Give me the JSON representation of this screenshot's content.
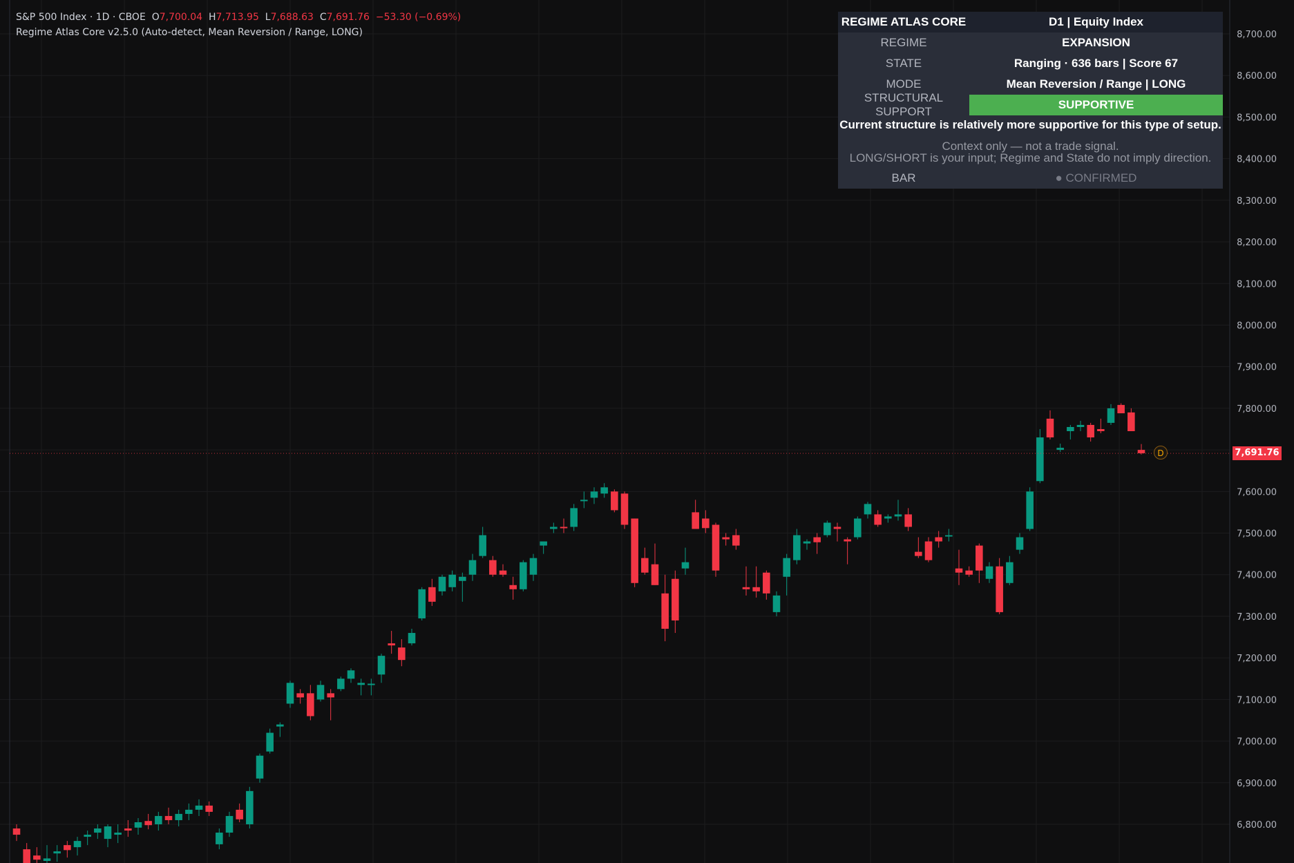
{
  "legend": {
    "symbol": "S&P 500 Index · 1D · CBOE",
    "o_label": "O",
    "o_value": "7,700.04",
    "h_label": "H",
    "h_value": "7,713.95",
    "l_label": "L",
    "l_value": "7,688.63",
    "c_label": "C",
    "c_value": "7,691.76",
    "change": "−53.30 (−0.69%)",
    "indicator": "Regime Atlas Core v2.5.0 (Auto-detect, Mean Reversion / Range, LONG)"
  },
  "panel": {
    "title": "REGIME ATLAS CORE",
    "title_value": "D1 | Equity Index",
    "regime_label": "REGIME",
    "regime_value": "EXPANSION",
    "state_label": "STATE",
    "state_value": "Ranging · 636 bars | Score 67",
    "mode_label": "MODE",
    "mode_value": "Mean Reversion / Range | LONG",
    "support_label": "STRUCTURAL SUPPORT",
    "support_value": "SUPPORTIVE",
    "note_strong": "Current structure is relatively more supportive for this type of setup.",
    "note_line1": "Context only — not a trade signal.",
    "note_line2": "LONG/SHORT is your input; Regime and State do not imply direction.",
    "bar_label": "BAR",
    "bar_value": "● CONFIRMED",
    "support_color": "#4caf50"
  },
  "price_tag": "7,691.76",
  "d_marker": "D",
  "colors": {
    "up": "#089981",
    "down": "#f23645",
    "background": "#0f0f10",
    "grid": "#1c1c1e",
    "axis_text": "#b2b5be"
  },
  "chart_data": {
    "type": "candlestick",
    "title": "S&P 500 Index · 1D · CBOE",
    "y_ticks": [
      "6,800.00",
      "6,900.00",
      "7,000.00",
      "7,100.00",
      "7,200.00",
      "7,300.00",
      "7,400.00",
      "7,500.00",
      "7,600.00",
      "7,700.00",
      "7,800.00",
      "7,900.00",
      "8,000.00",
      "8,100.00",
      "8,200.00",
      "8,300.00",
      "8,400.00",
      "8,500.00",
      "8,600.00",
      "8,700.00"
    ],
    "ylim": [
      6700,
      8760
    ],
    "last_price": 7691.76,
    "grid": true,
    "candles": [
      {
        "o": 6790,
        "h": 6800,
        "l": 6760,
        "c": 6775
      },
      {
        "o": 6740,
        "h": 6755,
        "l": 6690,
        "c": 6705
      },
      {
        "o": 6725,
        "h": 6745,
        "l": 6700,
        "c": 6715
      },
      {
        "o": 6712,
        "h": 6750,
        "l": 6690,
        "c": 6718
      },
      {
        "o": 6730,
        "h": 6750,
        "l": 6710,
        "c": 6735
      },
      {
        "o": 6750,
        "h": 6760,
        "l": 6720,
        "c": 6738
      },
      {
        "o": 6745,
        "h": 6770,
        "l": 6725,
        "c": 6760
      },
      {
        "o": 6770,
        "h": 6785,
        "l": 6750,
        "c": 6775
      },
      {
        "o": 6780,
        "h": 6800,
        "l": 6765,
        "c": 6790
      },
      {
        "o": 6765,
        "h": 6800,
        "l": 6745,
        "c": 6795
      },
      {
        "o": 6775,
        "h": 6800,
        "l": 6755,
        "c": 6780
      },
      {
        "o": 6790,
        "h": 6810,
        "l": 6770,
        "c": 6785
      },
      {
        "o": 6792,
        "h": 6815,
        "l": 6775,
        "c": 6805
      },
      {
        "o": 6808,
        "h": 6825,
        "l": 6788,
        "c": 6798
      },
      {
        "o": 6800,
        "h": 6830,
        "l": 6785,
        "c": 6820
      },
      {
        "o": 6820,
        "h": 6840,
        "l": 6800,
        "c": 6810
      },
      {
        "o": 6810,
        "h": 6835,
        "l": 6795,
        "c": 6825
      },
      {
        "o": 6825,
        "h": 6850,
        "l": 6810,
        "c": 6835
      },
      {
        "o": 6835,
        "h": 6860,
        "l": 6820,
        "c": 6845
      },
      {
        "o": 6845,
        "h": 6855,
        "l": 6820,
        "c": 6830
      },
      {
        "o": 6752,
        "h": 6790,
        "l": 6740,
        "c": 6780
      },
      {
        "o": 6780,
        "h": 6830,
        "l": 6770,
        "c": 6820
      },
      {
        "o": 6835,
        "h": 6850,
        "l": 6805,
        "c": 6812
      },
      {
        "o": 6800,
        "h": 6890,
        "l": 6790,
        "c": 6880
      },
      {
        "o": 6910,
        "h": 6970,
        "l": 6900,
        "c": 6965
      },
      {
        "o": 6975,
        "h": 7030,
        "l": 6970,
        "c": 7020
      },
      {
        "o": 7035,
        "h": 7045,
        "l": 7010,
        "c": 7040
      },
      {
        "o": 7090,
        "h": 7145,
        "l": 7080,
        "c": 7140
      },
      {
        "o": 7115,
        "h": 7125,
        "l": 7090,
        "c": 7105
      },
      {
        "o": 7115,
        "h": 7135,
        "l": 7050,
        "c": 7060
      },
      {
        "o": 7100,
        "h": 7145,
        "l": 7095,
        "c": 7135
      },
      {
        "o": 7115,
        "h": 7125,
        "l": 7050,
        "c": 7105
      },
      {
        "o": 7125,
        "h": 7155,
        "l": 7120,
        "c": 7150
      },
      {
        "o": 7150,
        "h": 7175,
        "l": 7140,
        "c": 7170
      },
      {
        "o": 7135,
        "h": 7150,
        "l": 7110,
        "c": 7140
      },
      {
        "o": 7135,
        "h": 7150,
        "l": 7110,
        "c": 7138
      },
      {
        "o": 7160,
        "h": 7210,
        "l": 7140,
        "c": 7205
      },
      {
        "o": 7235,
        "h": 7265,
        "l": 7210,
        "c": 7230
      },
      {
        "o": 7225,
        "h": 7245,
        "l": 7180,
        "c": 7195
      },
      {
        "o": 7235,
        "h": 7270,
        "l": 7230,
        "c": 7260
      },
      {
        "o": 7295,
        "h": 7370,
        "l": 7290,
        "c": 7365
      },
      {
        "o": 7370,
        "h": 7390,
        "l": 7325,
        "c": 7335
      },
      {
        "o": 7360,
        "h": 7400,
        "l": 7350,
        "c": 7395
      },
      {
        "o": 7370,
        "h": 7410,
        "l": 7360,
        "c": 7400
      },
      {
        "o": 7385,
        "h": 7405,
        "l": 7335,
        "c": 7395
      },
      {
        "o": 7400,
        "h": 7450,
        "l": 7385,
        "c": 7435
      },
      {
        "o": 7445,
        "h": 7515,
        "l": 7440,
        "c": 7495
      },
      {
        "o": 7435,
        "h": 7445,
        "l": 7395,
        "c": 7400
      },
      {
        "o": 7410,
        "h": 7425,
        "l": 7395,
        "c": 7400
      },
      {
        "o": 7375,
        "h": 7395,
        "l": 7340,
        "c": 7365
      },
      {
        "o": 7365,
        "h": 7435,
        "l": 7360,
        "c": 7430
      },
      {
        "o": 7400,
        "h": 7450,
        "l": 7385,
        "c": 7440
      },
      {
        "o": 7470,
        "h": 7475,
        "l": 7450,
        "c": 7480
      },
      {
        "o": 7510,
        "h": 7525,
        "l": 7500,
        "c": 7515
      },
      {
        "o": 7515,
        "h": 7535,
        "l": 7500,
        "c": 7512
      },
      {
        "o": 7515,
        "h": 7570,
        "l": 7505,
        "c": 7560
      },
      {
        "o": 7578,
        "h": 7600,
        "l": 7560,
        "c": 7580
      },
      {
        "o": 7585,
        "h": 7610,
        "l": 7570,
        "c": 7600
      },
      {
        "o": 7595,
        "h": 7620,
        "l": 7585,
        "c": 7610
      },
      {
        "o": 7600,
        "h": 7605,
        "l": 7550,
        "c": 7555
      },
      {
        "o": 7595,
        "h": 7600,
        "l": 7510,
        "c": 7520
      },
      {
        "o": 7535,
        "h": 7535,
        "l": 7370,
        "c": 7380
      },
      {
        "o": 7440,
        "h": 7465,
        "l": 7400,
        "c": 7405
      },
      {
        "o": 7425,
        "h": 7475,
        "l": 7375,
        "c": 7375
      },
      {
        "o": 7355,
        "h": 7400,
        "l": 7240,
        "c": 7270
      },
      {
        "o": 7390,
        "h": 7410,
        "l": 7260,
        "c": 7290
      },
      {
        "o": 7415,
        "h": 7465,
        "l": 7400,
        "c": 7430
      },
      {
        "o": 7550,
        "h": 7580,
        "l": 7520,
        "c": 7510
      },
      {
        "o": 7535,
        "h": 7555,
        "l": 7500,
        "c": 7512
      },
      {
        "o": 7520,
        "h": 7525,
        "l": 7395,
        "c": 7410
      },
      {
        "o": 7490,
        "h": 7500,
        "l": 7470,
        "c": 7485
      },
      {
        "o": 7495,
        "h": 7510,
        "l": 7460,
        "c": 7470
      },
      {
        "o": 7370,
        "h": 7420,
        "l": 7350,
        "c": 7365
      },
      {
        "o": 7370,
        "h": 7420,
        "l": 7345,
        "c": 7360
      },
      {
        "o": 7405,
        "h": 7410,
        "l": 7340,
        "c": 7355
      },
      {
        "o": 7310,
        "h": 7360,
        "l": 7300,
        "c": 7350
      },
      {
        "o": 7395,
        "h": 7450,
        "l": 7350,
        "c": 7440
      },
      {
        "o": 7435,
        "h": 7510,
        "l": 7425,
        "c": 7495
      },
      {
        "o": 7475,
        "h": 7485,
        "l": 7460,
        "c": 7480
      },
      {
        "o": 7490,
        "h": 7500,
        "l": 7450,
        "c": 7478
      },
      {
        "o": 7495,
        "h": 7530,
        "l": 7490,
        "c": 7525
      },
      {
        "o": 7515,
        "h": 7525,
        "l": 7480,
        "c": 7510
      },
      {
        "o": 7485,
        "h": 7490,
        "l": 7425,
        "c": 7480
      },
      {
        "o": 7490,
        "h": 7540,
        "l": 7485,
        "c": 7535
      },
      {
        "o": 7545,
        "h": 7575,
        "l": 7535,
        "c": 7570
      },
      {
        "o": 7545,
        "h": 7555,
        "l": 7515,
        "c": 7520
      },
      {
        "o": 7535,
        "h": 7545,
        "l": 7525,
        "c": 7540
      },
      {
        "o": 7540,
        "h": 7580,
        "l": 7530,
        "c": 7545
      },
      {
        "o": 7545,
        "h": 7560,
        "l": 7505,
        "c": 7515
      },
      {
        "o": 7455,
        "h": 7490,
        "l": 7440,
        "c": 7445
      },
      {
        "o": 7480,
        "h": 7490,
        "l": 7430,
        "c": 7435
      },
      {
        "o": 7490,
        "h": 7505,
        "l": 7465,
        "c": 7480
      },
      {
        "o": 7495,
        "h": 7510,
        "l": 7480,
        "c": 7495
      },
      {
        "o": 7415,
        "h": 7460,
        "l": 7375,
        "c": 7405
      },
      {
        "o": 7410,
        "h": 7420,
        "l": 7395,
        "c": 7400
      },
      {
        "o": 7470,
        "h": 7475,
        "l": 7380,
        "c": 7410
      },
      {
        "o": 7390,
        "h": 7430,
        "l": 7380,
        "c": 7420
      },
      {
        "o": 7420,
        "h": 7440,
        "l": 7305,
        "c": 7310
      },
      {
        "o": 7380,
        "h": 7445,
        "l": 7375,
        "c": 7430
      },
      {
        "o": 7460,
        "h": 7500,
        "l": 7450,
        "c": 7490
      },
      {
        "o": 7510,
        "h": 7610,
        "l": 7505,
        "c": 7600
      },
      {
        "o": 7625,
        "h": 7750,
        "l": 7620,
        "c": 7730
      },
      {
        "o": 7775,
        "h": 7795,
        "l": 7725,
        "c": 7730
      },
      {
        "o": 7700,
        "h": 7715,
        "l": 7695,
        "c": 7705
      },
      {
        "o": 7745,
        "h": 7760,
        "l": 7725,
        "c": 7755
      },
      {
        "o": 7755,
        "h": 7770,
        "l": 7745,
        "c": 7760
      },
      {
        "o": 7760,
        "h": 7765,
        "l": 7720,
        "c": 7730
      },
      {
        "o": 7750,
        "h": 7775,
        "l": 7740,
        "c": 7745
      },
      {
        "o": 7765,
        "h": 7810,
        "l": 7760,
        "c": 7800
      },
      {
        "o": 7808,
        "h": 7812,
        "l": 7790,
        "c": 7788
      },
      {
        "o": 7790,
        "h": 7800,
        "l": 7750,
        "c": 7745
      },
      {
        "o": 7700,
        "h": 7714,
        "l": 7689,
        "c": 7692
      }
    ]
  }
}
